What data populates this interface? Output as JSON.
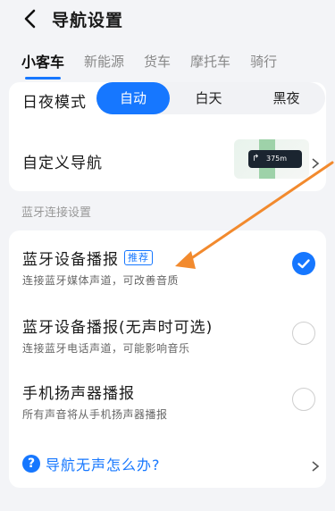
{
  "header": {
    "title": "导航设置"
  },
  "tabs": [
    {
      "label": "小客车"
    },
    {
      "label": "新能源"
    },
    {
      "label": "货车"
    },
    {
      "label": "摩托车"
    },
    {
      "label": "骑行"
    }
  ],
  "day_night": {
    "label": "日夜模式",
    "options": [
      "自动",
      "白天",
      "黑夜"
    ],
    "selected": "自动"
  },
  "custom_nav": {
    "label": "自定义导航",
    "preview_text": "375m"
  },
  "bluetooth_section": {
    "title": "蓝牙连接设置",
    "options": [
      {
        "title": "蓝牙设备播报",
        "tag": "推荐",
        "subtitle": "连接蓝牙媒体声道，可改善音质",
        "checked": true
      },
      {
        "title": "蓝牙设备播报(无声时可选)",
        "subtitle": "连接蓝牙电话声道，可能影响音乐",
        "checked": false
      },
      {
        "title": "手机扬声器播报",
        "subtitle": "所有声音将从手机扬声器播报",
        "checked": false
      }
    ],
    "help": "导航无声怎么办?"
  },
  "colors": {
    "accent": "#1677ff",
    "annotation": "#f28a2e"
  }
}
